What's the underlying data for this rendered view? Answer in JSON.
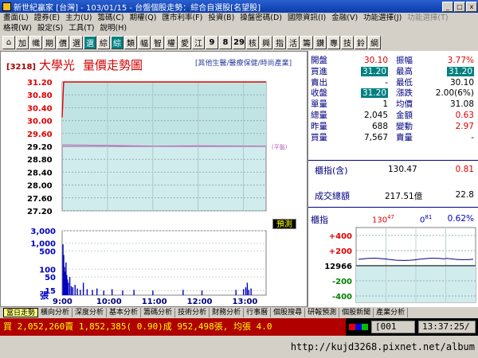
{
  "window": {
    "app_title": "新世紀贏家",
    "market": "[台灣]",
    "date": "103/01/15",
    "page_title": "台盤個股走勢：綜合自選股[名望股]",
    "min_label": "_",
    "max_label": "□",
    "close_label": "x"
  },
  "menu": [
    {
      "label": "畫面(L)",
      "enabled": true
    },
    {
      "label": "證券(E)",
      "enabled": true
    },
    {
      "label": "主力(U)",
      "enabled": true
    },
    {
      "label": "籌碼(C)",
      "enabled": true
    },
    {
      "label": "期權(Q)",
      "enabled": true
    },
    {
      "label": "匯市利率(F)",
      "enabled": true
    },
    {
      "label": "投資(B)",
      "enabled": true
    },
    {
      "label": "操盤密碼(D)",
      "enabled": true
    },
    {
      "label": "國際資訊(I)",
      "enabled": true
    },
    {
      "label": "金融(V)",
      "enabled": true
    },
    {
      "label": "功能選擇(J)",
      "enabled": true
    },
    {
      "label": "功能選擇(T)",
      "enabled": false
    },
    {
      "label": "格視(W)",
      "enabled": true
    },
    {
      "label": "設定(S)",
      "enabled": true
    },
    {
      "label": "工具(T)",
      "enabled": true
    },
    {
      "label": "說明(H)",
      "enabled": true
    }
  ],
  "toolbar": [
    {
      "label": "⌂",
      "icon": "home-icon",
      "kind": "icon"
    },
    {
      "label": "加",
      "kind": "text"
    },
    {
      "label": "幟",
      "kind": "text"
    },
    {
      "label": "期",
      "kind": "text"
    },
    {
      "label": "價",
      "kind": "text"
    },
    {
      "label": "選",
      "kind": "text"
    },
    {
      "label": "選",
      "kind": "sel"
    },
    {
      "label": "綜",
      "kind": "text"
    },
    {
      "label": "綜",
      "kind": "sel"
    },
    {
      "label": "類",
      "kind": "text"
    },
    {
      "label": "幅",
      "kind": "text"
    },
    {
      "label": "智",
      "kind": "text"
    },
    {
      "label": "權",
      "kind": "text"
    },
    {
      "label": "愛",
      "kind": "text"
    },
    {
      "label": "江",
      "kind": "text"
    },
    {
      "label": "9",
      "kind": "num"
    },
    {
      "label": "8",
      "kind": "num"
    },
    {
      "label": "29",
      "kind": "num"
    },
    {
      "label": "核",
      "kind": "text"
    },
    {
      "label": "興",
      "kind": "text"
    },
    {
      "label": "指",
      "kind": "text"
    },
    {
      "label": "活",
      "kind": "text"
    },
    {
      "label": "籌",
      "kind": "text"
    },
    {
      "label": "鑽",
      "kind": "text"
    },
    {
      "label": "專",
      "kind": "text"
    },
    {
      "label": "技",
      "kind": "text"
    },
    {
      "label": "鈴",
      "kind": "text"
    },
    {
      "label": "綱",
      "kind": "text"
    }
  ],
  "stock": {
    "code": "[3218]",
    "name": "大學光",
    "chart_title": "量價走勢圖",
    "category": "[其他生醫/醫療保健/時尚產業]",
    "ref_label": "(平盤)",
    "predict_label": "預測"
  },
  "quote": [
    {
      "l1": "開盤",
      "v1": "30.10",
      "c1": "red",
      "h1": false,
      "l2": "振幅",
      "v2": "3.77%",
      "c2": "red",
      "h2": false
    },
    {
      "l1": "買進",
      "v1": "31.20",
      "c1": "red",
      "h1": true,
      "l2": "最高",
      "v2": "31.20",
      "c2": "red",
      "h2": true
    },
    {
      "l1": "賣出",
      "v1": "-",
      "c1": "blk",
      "h1": false,
      "l2": "最低",
      "v2": "30.10",
      "c2": "blk",
      "h2": false
    },
    {
      "l1": "收盤",
      "v1": "31.20",
      "c1": "red",
      "h1": true,
      "l2": "漲跌",
      "v2": "2.00(6%)",
      "c2": "blk",
      "h2": false
    },
    {
      "l1": "單量",
      "v1": "1",
      "c1": "blk",
      "h1": false,
      "l2": "均價",
      "v2": "31.08",
      "c2": "blk",
      "h2": false
    },
    {
      "l1": "總量",
      "v1": "2,045",
      "c1": "blk",
      "h1": false,
      "l2": "金額",
      "v2": "0.63",
      "c2": "red",
      "h2": false
    },
    {
      "l1": "昨量",
      "v1": "688",
      "c1": "blk",
      "h1": false,
      "l2": "變動",
      "v2": "2.97",
      "c2": "red",
      "h2": false
    },
    {
      "l1": "買量",
      "v1": "7,567",
      "c1": "blk",
      "h1": false,
      "l2": "賣量",
      "v2": "-",
      "c2": "blk",
      "h2": false
    }
  ],
  "index_box": {
    "label": "櫃指(含)",
    "value": "130.47",
    "change": "0.81",
    "turnover_label": "成交總額",
    "turnover": "217.51億",
    "turnover_pct": "22.8"
  },
  "mini": {
    "label": "櫃指",
    "value": "130",
    "value_sup": "47",
    "change": "0",
    "change_sup": "81",
    "pct": "0.62%",
    "ticks": [
      "+400",
      "+200",
      "12966",
      "-200",
      "-400"
    ]
  },
  "chart_data": {
    "type": "line",
    "y_ticks": [
      "31.20",
      "30.80",
      "30.40",
      "30.00",
      "29.60",
      "29.20",
      "28.80",
      "28.40",
      "28.00",
      "27.60",
      "27.20"
    ],
    "ylim": [
      27.2,
      31.2
    ],
    "ref_price": 29.2,
    "x_ticks": [
      "9:00",
      "10:00",
      "11:00",
      "12:00",
      "13:00"
    ],
    "price_series": [
      {
        "t": 0,
        "v": 30.1
      },
      {
        "t": 2,
        "v": 31.2
      },
      {
        "t": 270,
        "v": 31.2
      }
    ],
    "avg_series": [
      {
        "t": 0,
        "v": 29.25
      },
      {
        "t": 60,
        "v": 29.23
      },
      {
        "t": 120,
        "v": 29.21
      },
      {
        "t": 180,
        "v": 29.22
      },
      {
        "t": 270,
        "v": 29.21
      }
    ],
    "vol_ticks": [
      "3,000",
      "1,000",
      "500",
      "100",
      "50",
      "15"
    ],
    "vol_unit": "張",
    "volumes": [
      {
        "t": 1,
        "v": 900
      },
      {
        "t": 2,
        "v": 350
      },
      {
        "t": 3,
        "v": 120
      },
      {
        "t": 4,
        "v": 80
      },
      {
        "t": 5,
        "v": 180
      },
      {
        "t": 6,
        "v": 60
      },
      {
        "t": 7,
        "v": 40
      },
      {
        "t": 8,
        "v": 30
      },
      {
        "t": 10,
        "v": 50
      },
      {
        "t": 12,
        "v": 22
      },
      {
        "t": 14,
        "v": 20
      },
      {
        "t": 17,
        "v": 25
      },
      {
        "t": 20,
        "v": 18
      },
      {
        "t": 24,
        "v": 16
      },
      {
        "t": 28,
        "v": 30
      },
      {
        "t": 33,
        "v": 17
      },
      {
        "t": 40,
        "v": 16
      },
      {
        "t": 46,
        "v": 18
      },
      {
        "t": 55,
        "v": 15
      },
      {
        "t": 66,
        "v": 17
      },
      {
        "t": 80,
        "v": 15
      },
      {
        "t": 95,
        "v": 16
      },
      {
        "t": 120,
        "v": 15
      },
      {
        "t": 160,
        "v": 16
      },
      {
        "t": 185,
        "v": 15
      },
      {
        "t": 230,
        "v": 16
      },
      {
        "t": 240,
        "v": 17
      },
      {
        "t": 243,
        "v": 20
      },
      {
        "t": 245,
        "v": 30
      },
      {
        "t": 247,
        "v": 16
      },
      {
        "t": 250,
        "v": 18
      }
    ]
  },
  "tabs": [
    {
      "label": "當日走勢",
      "active": true
    },
    {
      "label": "橫向分析",
      "active": false
    },
    {
      "label": "深度分析",
      "active": false
    },
    {
      "label": "基本分析",
      "active": false
    },
    {
      "label": "籌碼分析",
      "active": false
    },
    {
      "label": "技術分析",
      "active": false
    },
    {
      "label": "財務分析",
      "active": false
    },
    {
      "label": "行事曆",
      "active": false
    },
    {
      "label": "個股搜尋",
      "active": false
    },
    {
      "label": "研報預測",
      "active": false
    },
    {
      "label": "個股新聞",
      "active": false
    },
    {
      "label": "產業分析",
      "active": false
    }
  ],
  "status": {
    "text": "買 2,052,260賣 1,852,385( 0.90)成 952,498張, 均張 4.0",
    "code": "[001",
    "time": "13:37:25/"
  },
  "watermark": "http://kujd3268.pixnet.net/album",
  "colors": {
    "accent": "#008080",
    "up": "#e00000",
    "down": "#008000",
    "plot_fill": "#d0ecec"
  }
}
